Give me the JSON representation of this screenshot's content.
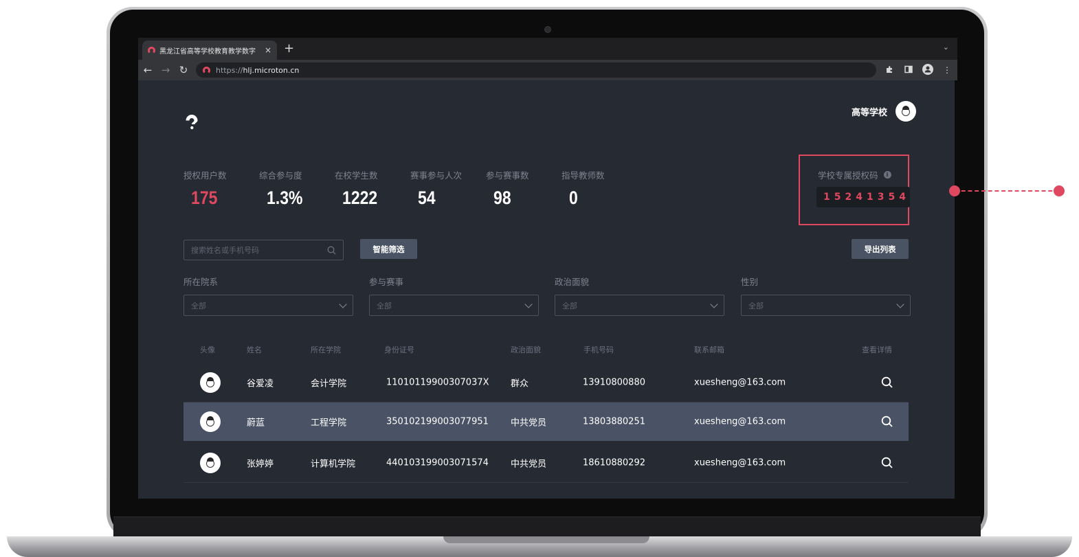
{
  "colors": {
    "accent": "#e0485f",
    "page_bg": "#262a32",
    "button_bg": "#4a5363",
    "row_highlight": "#495365"
  },
  "browser": {
    "tab_title": "黑龙江省高等学校教育教学数字",
    "tab_close": "×",
    "new_tab": "+",
    "tab_menu": "⌄",
    "url_scheme": "https://",
    "url_host": "hlj.microton.cn",
    "icons": [
      "back-icon",
      "forward-icon",
      "reload-icon",
      "extensions-icon",
      "side-panel-icon",
      "profile-icon",
      "menu-icon"
    ]
  },
  "header": {
    "user_name": "高等学校"
  },
  "stats": [
    {
      "label": "授权用户数",
      "value": "175"
    },
    {
      "label": "综合参与度",
      "value": "1.3%"
    },
    {
      "label": "在校学生数",
      "value": "1222"
    },
    {
      "label": "赛事参与人次",
      "value": "54"
    },
    {
      "label": "参与赛事数",
      "value": "98"
    },
    {
      "label": "指导教师数",
      "value": "0"
    }
  ],
  "auth_code": {
    "label": "学校专属授权码",
    "value": "15241354"
  },
  "search": {
    "placeholder": "搜索姓名或手机号码"
  },
  "buttons": {
    "smart_filter": "智能筛选",
    "export": "导出列表"
  },
  "filters": [
    {
      "label": "所在院系",
      "value": "全部"
    },
    {
      "label": "参与赛事",
      "value": "全部"
    },
    {
      "label": "政治面貌",
      "value": "全部"
    },
    {
      "label": "性别",
      "value": "全部"
    }
  ],
  "table": {
    "headers": [
      "头像",
      "姓名",
      "所在学院",
      "身份证号",
      "政治面貌",
      "手机号码",
      "联系邮箱",
      "查看详情"
    ],
    "rows": [
      {
        "name": "谷爱凌",
        "college": "会计学院",
        "id_number": "11010119900307037X",
        "political": "群众",
        "phone": "13910800880",
        "email": "xuesheng@163.com",
        "highlighted": false
      },
      {
        "name": "蔚蓝",
        "college": "工程学院",
        "id_number": "350102199003077951",
        "political": "中共党员",
        "phone": "13803880251",
        "email": "xuesheng@163.com",
        "highlighted": true
      },
      {
        "name": "张婷婷",
        "college": "计算机学院",
        "id_number": "440103199003071574",
        "political": "中共党员",
        "phone": "18610880292",
        "email": "xuesheng@163.com",
        "highlighted": false
      }
    ]
  }
}
